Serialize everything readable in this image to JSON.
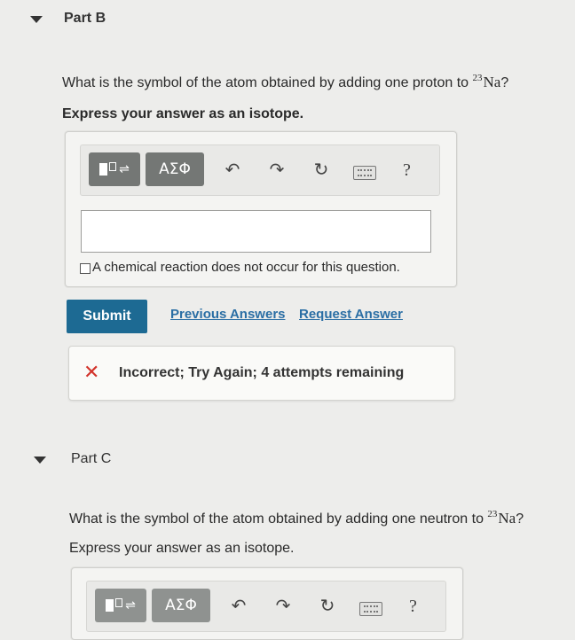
{
  "part_b": {
    "title": "Part B",
    "question_text": "What is the symbol of the atom obtained by adding one proton to ",
    "isotope_mass": "23",
    "isotope_symbol": "Na",
    "question_end": "?",
    "instruction": "Express your answer as an isotope.",
    "toolbar": {
      "greek_label": "ΑΣΦ",
      "help_label": "?",
      "undo_icon": "undo-icon",
      "redo_icon": "redo-icon",
      "reset_icon": "reset-icon",
      "keyboard_icon": "keyboard-icon",
      "template_icon": "template-icon"
    },
    "answer_value": "",
    "no_reaction_label": "A chemical reaction does not occur for this question.",
    "submit_label": "Submit",
    "previous_answers_label": "Previous Answers",
    "request_answer_label": "Request Answer",
    "feedback_text": "Incorrect; Try Again; 4 attempts remaining"
  },
  "part_c": {
    "title": "Part C",
    "question_text": "What is the symbol of the atom obtained by adding one neutron to ",
    "isotope_mass": "23",
    "isotope_symbol": "Na",
    "question_end": "?",
    "instruction": "Express your answer as an isotope.",
    "toolbar": {
      "greek_label": "ΑΣΦ",
      "help_label": "?"
    }
  },
  "colors": {
    "background": "#ededeb",
    "submit": "#1d6a93",
    "link": "#2a6ea4",
    "error": "#d2332b",
    "toolbar_button": "#747775"
  }
}
